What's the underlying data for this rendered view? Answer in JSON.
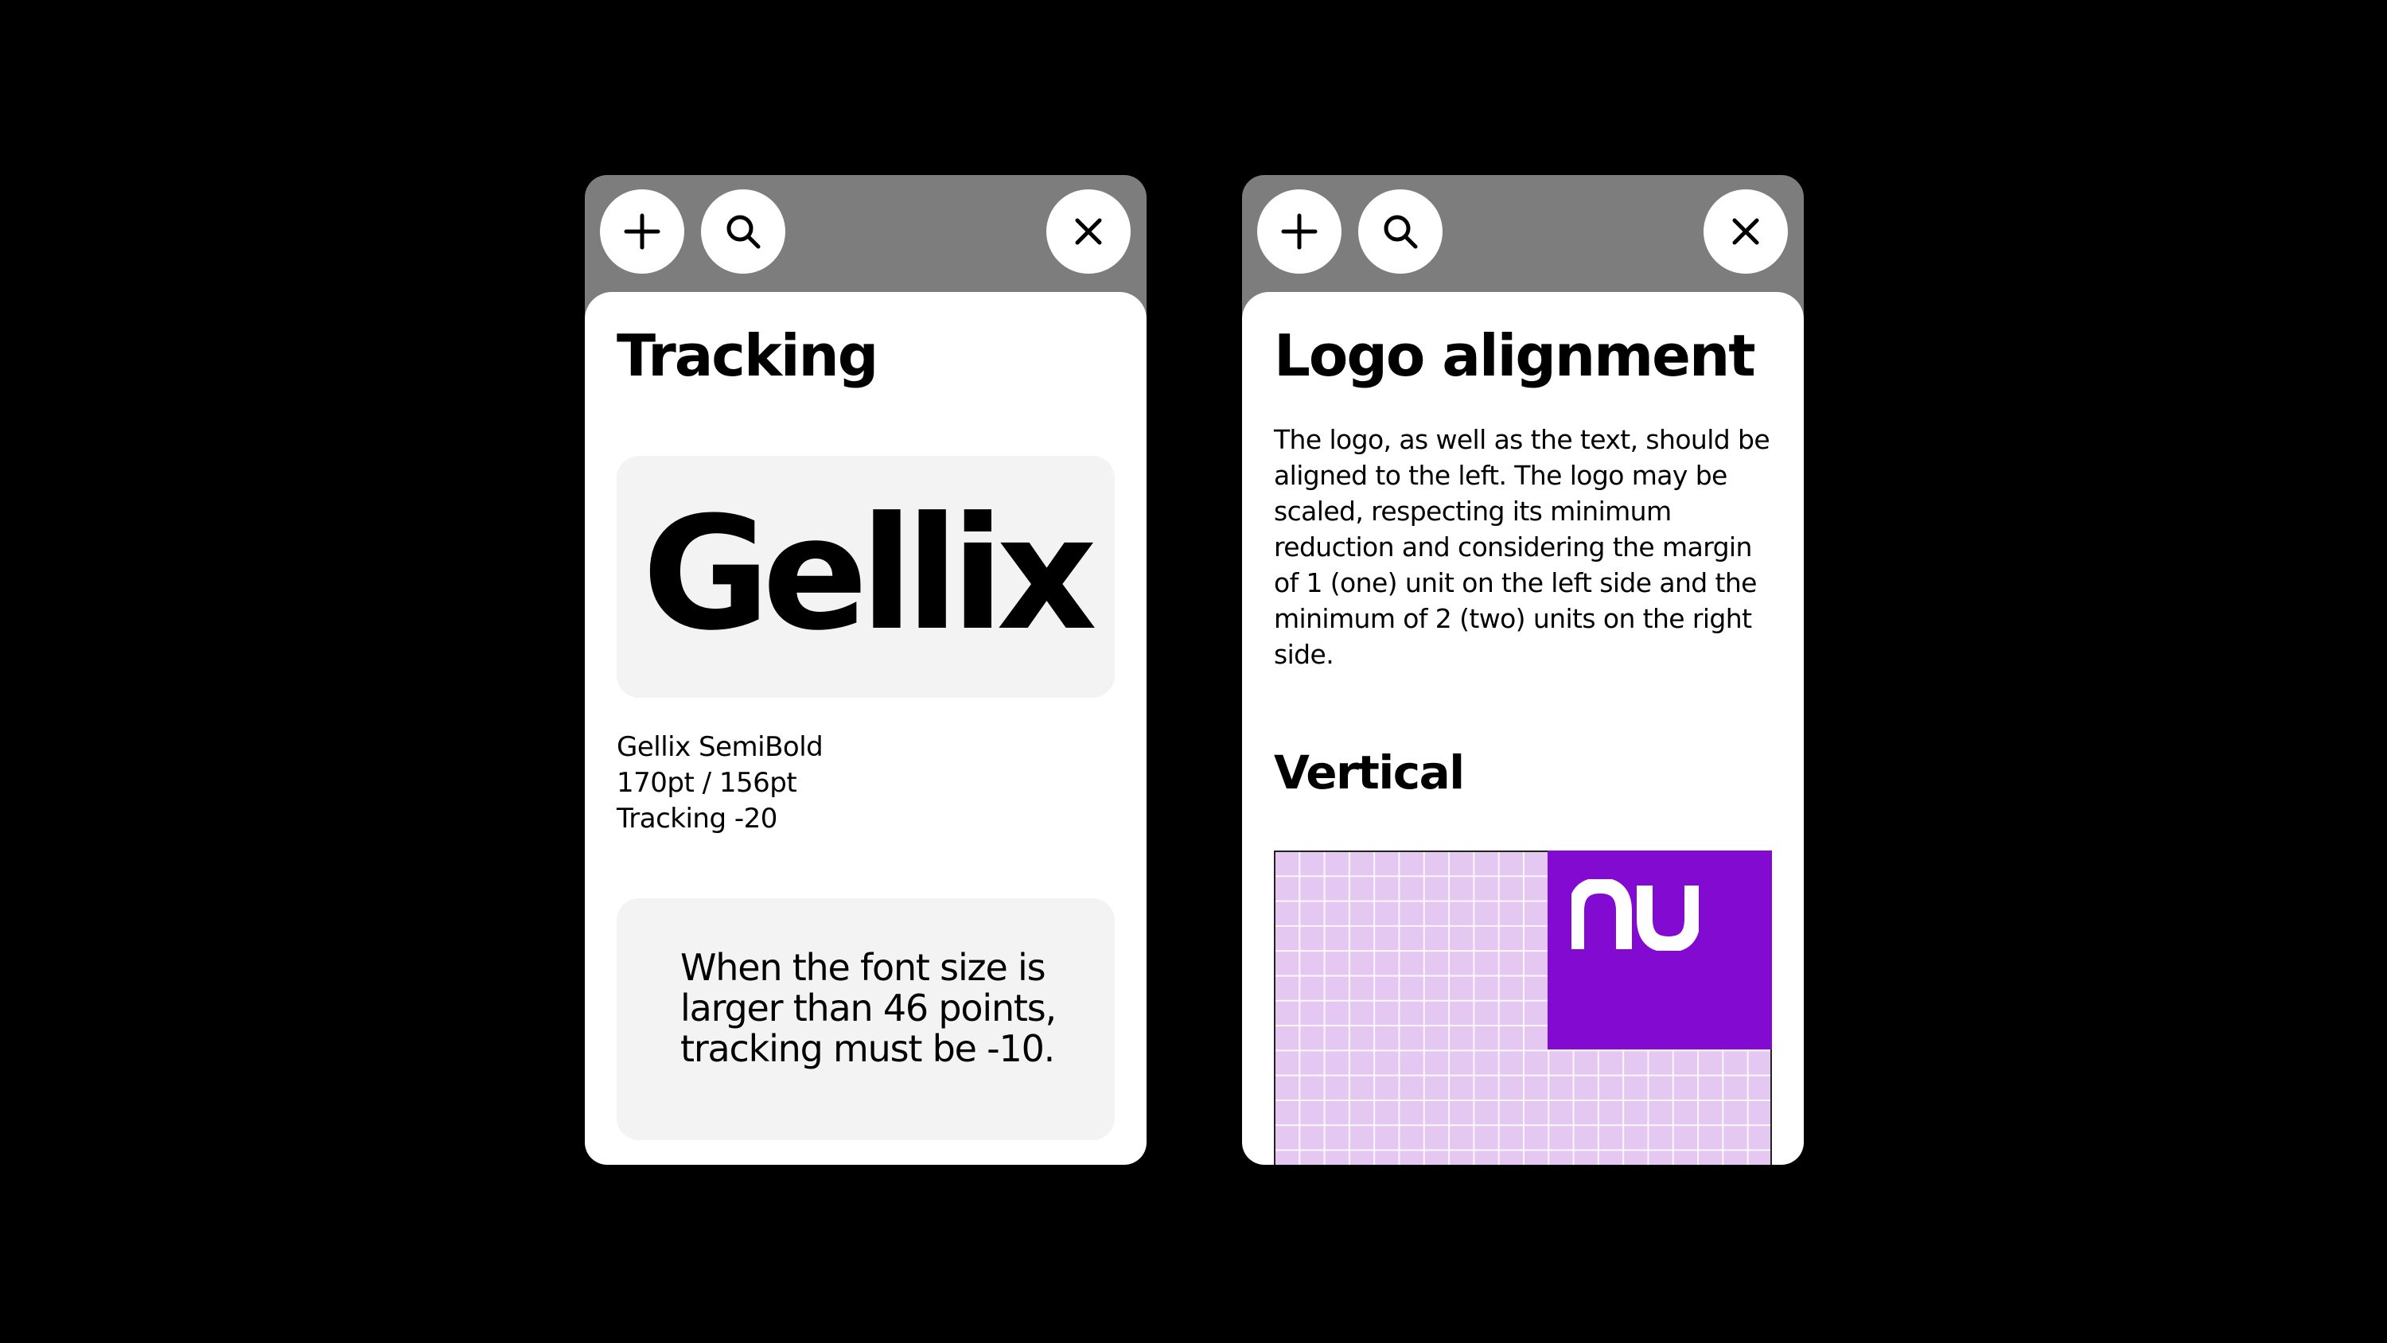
{
  "colors": {
    "background": "#000000",
    "toolbar": "#7d7d7d",
    "panel": "#ffffff",
    "card": "#f3f3f3",
    "grid": "#e4c8f1",
    "brand_purple": "#820ad1"
  },
  "icons": {
    "add": "plus-icon",
    "search": "search-icon",
    "close": "close-icon",
    "logo": "nu-logo"
  },
  "left_window": {
    "title": "Tracking",
    "specimen": "Gellix",
    "specs": [
      "Gellix SemiBold",
      "170pt / 156pt",
      "Tracking -20"
    ],
    "note": "When the font size is larger than 46 points, tracking must be -10."
  },
  "right_window": {
    "title": "Logo alignment",
    "body": "The logo, as well as the text, should be aligned to the left. The logo may be scaled, respecting its minimum reduction and considering the margin of 1 (one) unit on the left side and the minimum of 2 (two) units on the right side.",
    "subtitle": "Vertical",
    "logo_text": "nu"
  }
}
